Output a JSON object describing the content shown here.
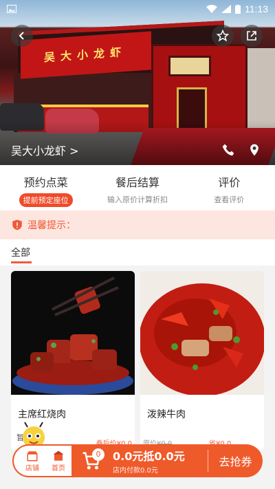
{
  "status_bar": {
    "time": "11:13"
  },
  "hero": {
    "store_name": "吴大小龙虾 >",
    "sign_text": "吴大小龙虾"
  },
  "actions": [
    {
      "title": "预约点菜",
      "badge": "提前预定座位"
    },
    {
      "title": "餐后结算",
      "subtitle": "输入原价计算折扣"
    },
    {
      "title": "评价",
      "subtitle": "查看评价"
    }
  ],
  "notice": {
    "label": "温馨提示："
  },
  "filter": {
    "all_label": "全部"
  },
  "dishes": [
    {
      "name": "主席红烧肉",
      "price_after": "券后价¥0.0"
    },
    {
      "name": "泼辣牛肉",
      "price_orig_label": "原价",
      "price_orig": "¥0.0",
      "save": "省¥0.0"
    }
  ],
  "mascot_label": "暂",
  "bottom_bar": {
    "store_label": "店铺",
    "home_label": "首页",
    "cart_count": "0",
    "total_main": "0.0元抵0.0元",
    "total_sub": "店内付款0.0元",
    "cta": "去抢券"
  },
  "colors": {
    "accent": "#ef5a2a",
    "badge": "#ef4b2a",
    "notice_bg": "#fde6df"
  }
}
